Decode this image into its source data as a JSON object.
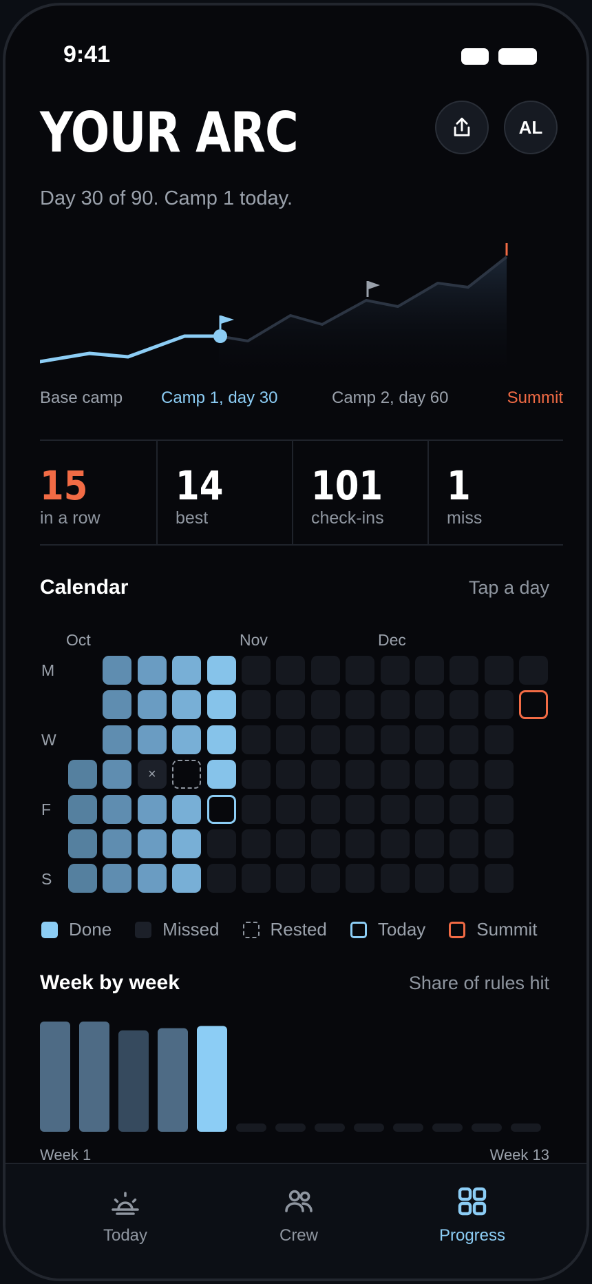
{
  "status": {
    "time": "9:41"
  },
  "header": {
    "title": "YOUR ARC",
    "avatar_initials": "AL",
    "share_icon": "share-icon"
  },
  "subtitle": "Day 30 of 90. Camp 1 today.",
  "arc": {
    "labels": [
      "Base camp",
      "Camp 1, day 30",
      "Camp 2, day 60",
      "Summit"
    ],
    "colors": {
      "done": "#8ccdf5",
      "summit": "#f26b45",
      "muted": "#9aa1ab"
    }
  },
  "stats": [
    {
      "value": "15",
      "label": "in a row"
    },
    {
      "value": "14",
      "label": "best"
    },
    {
      "value": "101",
      "label": "check-ins"
    },
    {
      "value": "1",
      "label": "miss"
    }
  ],
  "calendar": {
    "title": "Calendar",
    "hint": "Tap a day",
    "months": [
      "Oct",
      "Nov",
      "Dec"
    ],
    "day_labels": [
      "M",
      "W",
      "F",
      "S"
    ]
  },
  "legend": [
    {
      "key": "done",
      "label": "Done"
    },
    {
      "key": "missed",
      "label": "Missed"
    },
    {
      "key": "rested",
      "label": "Rested"
    },
    {
      "key": "today",
      "label": "Today"
    },
    {
      "key": "summit",
      "label": "Summit"
    }
  ],
  "weeks": {
    "title": "Week by week",
    "hint": "Share of rules hit",
    "first_label": "Week 1",
    "last_label": "Week 13",
    "values": [
      1.0,
      1.0,
      0.92,
      0.94,
      0.96,
      0,
      0,
      0,
      0,
      0,
      0,
      0,
      0
    ],
    "current_index": 4
  },
  "tabs": [
    {
      "label": "Today",
      "icon": "sunrise-icon"
    },
    {
      "label": "Crew",
      "icon": "people-icon"
    },
    {
      "label": "Progress",
      "icon": "grid-icon",
      "active": true
    }
  ]
}
